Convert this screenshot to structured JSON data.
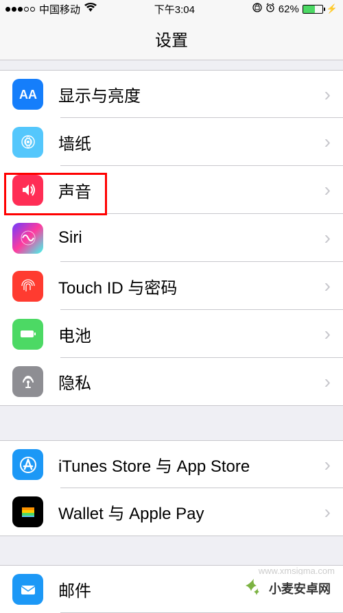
{
  "statusBar": {
    "carrier": "中国移动",
    "time": "下午3:04",
    "battery": "62%",
    "batteryFill": "62%"
  },
  "nav": {
    "title": "设置"
  },
  "groups": [
    {
      "items": [
        {
          "label": "显示与亮度",
          "iconName": "display-brightness-icon",
          "iconBg": "#157efb",
          "iconFg": "#ffffff"
        },
        {
          "label": "墙纸",
          "iconName": "wallpaper-icon",
          "iconBg": "#54c7fc",
          "iconFg": "#ffffff"
        },
        {
          "label": "声音",
          "iconName": "sounds-icon",
          "iconBg": "#ff3b30",
          "iconFg": "#ffffff",
          "highlighted": true
        },
        {
          "label": "Siri",
          "iconName": "siri-icon",
          "iconBg": "#000000",
          "iconFg": "#ffffff"
        },
        {
          "label": "Touch ID 与密码",
          "iconName": "touchid-icon",
          "iconBg": "#ff3b30",
          "iconFg": "#ffffff"
        },
        {
          "label": "电池",
          "iconName": "battery-icon",
          "iconBg": "#4cd964",
          "iconFg": "#ffffff"
        },
        {
          "label": "隐私",
          "iconName": "privacy-icon",
          "iconBg": "#8e8e93",
          "iconFg": "#ffffff"
        }
      ]
    },
    {
      "items": [
        {
          "label": "iTunes Store 与 App Store",
          "iconName": "appstore-icon",
          "iconBg": "#1c98f6",
          "iconFg": "#ffffff"
        },
        {
          "label": "Wallet 与 Apple Pay",
          "iconName": "wallet-icon",
          "iconBg": "#000000",
          "iconFg": "#ffffff"
        }
      ]
    },
    {
      "items": [
        {
          "label": "邮件",
          "iconName": "mail-icon",
          "iconBg": "#1c98f6",
          "iconFg": "#ffffff"
        }
      ]
    }
  ],
  "footer": {
    "text": "小麦安卓网",
    "url": "www.xmsigma.com"
  }
}
